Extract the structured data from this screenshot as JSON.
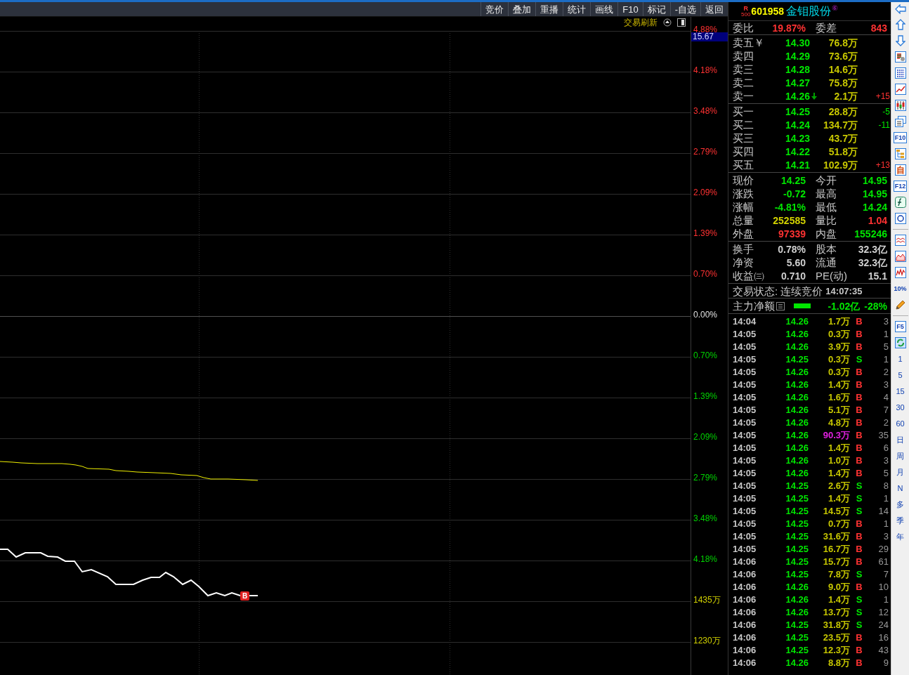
{
  "toolbar": [
    "竞价",
    "叠加",
    "重播",
    "统计",
    "画线",
    "F10",
    "标记",
    "-自选",
    "返回"
  ],
  "chart": {
    "refresh_label": "交易刷新",
    "price_tag": "15.67",
    "axis_labels": [
      {
        "text": "4.88%",
        "color": "#ff3232"
      },
      {
        "text": "4.18%",
        "color": "#ff3232"
      },
      {
        "text": "3.48%",
        "color": "#ff3232"
      },
      {
        "text": "2.79%",
        "color": "#ff3232"
      },
      {
        "text": "2.09%",
        "color": "#ff3232"
      },
      {
        "text": "1.39%",
        "color": "#ff3232"
      },
      {
        "text": "0.70%",
        "color": "#ff3232"
      },
      {
        "text": "0.00%",
        "color": "#e0e0e0"
      },
      {
        "text": "0.70%",
        "color": "#00d200"
      },
      {
        "text": "1.39%",
        "color": "#00d200"
      },
      {
        "text": "2.09%",
        "color": "#00d200"
      },
      {
        "text": "2.79%",
        "color": "#00d200"
      },
      {
        "text": "3.48%",
        "color": "#00d200"
      },
      {
        "text": "4.18%",
        "color": "#00d200"
      },
      {
        "text": "1435万",
        "color": "#d2d200"
      },
      {
        "text": "1230万",
        "color": "#d2d200"
      }
    ],
    "marker": "B"
  },
  "quote": {
    "market_tag": "R",
    "index_tag": "500",
    "code": "601958",
    "name": "金钼股份",
    "badge": "⑥",
    "ratio": {
      "label": "委比",
      "value": "19.87%",
      "diff_label": "委差",
      "diff": "843"
    },
    "asks": [
      {
        "label": "卖五￥",
        "price": "14.30",
        "volume": "76.8万",
        "tick_down": false
      },
      {
        "label": "卖四",
        "price": "14.29",
        "volume": "73.6万",
        "tick_down": false
      },
      {
        "label": "卖三",
        "price": "14.28",
        "volume": "14.6万",
        "tick_down": false
      },
      {
        "label": "卖二",
        "price": "14.27",
        "volume": "75.8万",
        "tick_down": false
      },
      {
        "label": "卖一",
        "price": "14.26",
        "volume": "2.1万",
        "change": "+15",
        "up": true,
        "tick_down": true
      }
    ],
    "bids": [
      {
        "label": "买一",
        "price": "14.25",
        "volume": "28.8万",
        "change": "-5",
        "up": false,
        "tick_down": false
      },
      {
        "label": "买二",
        "price": "14.24",
        "volume": "134.7万",
        "change": "-11",
        "up": false,
        "tick_down": false
      },
      {
        "label": "买三",
        "price": "14.23",
        "volume": "43.7万",
        "tick_down": false
      },
      {
        "label": "买四",
        "price": "14.22",
        "volume": "51.8万",
        "tick_down": false
      },
      {
        "label": "买五",
        "price": "14.21",
        "volume": "102.9万",
        "change": "+13",
        "up": true,
        "tick_down": false
      }
    ],
    "stats": [
      [
        {
          "label": "现价",
          "value": "14.25",
          "color": "#00e600"
        },
        {
          "label": "今开",
          "value": "14.95",
          "color": "#00e600"
        }
      ],
      [
        {
          "label": "涨跌",
          "value": "-0.72",
          "color": "#00e600"
        },
        {
          "label": "最高",
          "value": "14.95",
          "color": "#00e600"
        }
      ],
      [
        {
          "label": "涨幅",
          "value": "-4.81%",
          "color": "#00e600"
        },
        {
          "label": "最低",
          "value": "14.24",
          "color": "#00e600"
        }
      ],
      [
        {
          "label": "总量",
          "value": "252585",
          "color": "#d2d200"
        },
        {
          "label": "量比",
          "value": "1.04",
          "color": "#ff3232"
        }
      ],
      [
        {
          "label": "外盘",
          "value": "97339",
          "color": "#ff3232"
        },
        {
          "label": "内盘",
          "value": "155246",
          "color": "#00e600"
        }
      ]
    ],
    "fundamentals": [
      [
        {
          "label": "换手",
          "value": "0.78%",
          "color": "#d0d0d0"
        },
        {
          "label": "股本",
          "value": "32.3亿",
          "color": "#d0d0d0"
        }
      ],
      [
        {
          "label": "净资",
          "value": "5.60",
          "color": "#d0d0d0"
        },
        {
          "label": "流通",
          "value": "32.3亿",
          "color": "#d0d0d0"
        }
      ],
      [
        {
          "label": "收益㈢",
          "value": "0.710",
          "color": "#d0d0d0"
        },
        {
          "label": "PE(动)",
          "value": "15.1",
          "color": "#d0d0d0"
        }
      ]
    ],
    "status": {
      "text": "交易状态: 连续竞价",
      "time": "14:07:35"
    },
    "main_flow": {
      "label": "主力净额",
      "amount": "-1.02亿",
      "percent": "-28%",
      "level": 0.5
    }
  },
  "trades": [
    {
      "time": "14:04",
      "price": "14.26",
      "volume": "1.7万",
      "side": "B",
      "count": "3",
      "large": false
    },
    {
      "time": "14:05",
      "price": "14.26",
      "volume": "0.3万",
      "side": "B",
      "count": "1",
      "large": false
    },
    {
      "time": "14:05",
      "price": "14.26",
      "volume": "3.9万",
      "side": "B",
      "count": "5",
      "large": false
    },
    {
      "time": "14:05",
      "price": "14.25",
      "volume": "0.3万",
      "side": "S",
      "count": "1",
      "large": false
    },
    {
      "time": "14:05",
      "price": "14.26",
      "volume": "0.3万",
      "side": "B",
      "count": "2",
      "large": false
    },
    {
      "time": "14:05",
      "price": "14.26",
      "volume": "1.4万",
      "side": "B",
      "count": "3",
      "large": false
    },
    {
      "time": "14:05",
      "price": "14.26",
      "volume": "1.6万",
      "side": "B",
      "count": "4",
      "large": false
    },
    {
      "time": "14:05",
      "price": "14.26",
      "volume": "5.1万",
      "side": "B",
      "count": "7",
      "large": false
    },
    {
      "time": "14:05",
      "price": "14.26",
      "volume": "4.8万",
      "side": "B",
      "count": "2",
      "large": false
    },
    {
      "time": "14:05",
      "price": "14.26",
      "volume": "90.3万",
      "side": "B",
      "count": "35",
      "large": true
    },
    {
      "time": "14:05",
      "price": "14.26",
      "volume": "1.4万",
      "side": "B",
      "count": "6",
      "large": false
    },
    {
      "time": "14:05",
      "price": "14.26",
      "volume": "1.0万",
      "side": "B",
      "count": "3",
      "large": false
    },
    {
      "time": "14:05",
      "price": "14.26",
      "volume": "1.4万",
      "side": "B",
      "count": "5",
      "large": false
    },
    {
      "time": "14:05",
      "price": "14.25",
      "volume": "2.6万",
      "side": "S",
      "count": "8",
      "large": false
    },
    {
      "time": "14:05",
      "price": "14.25",
      "volume": "1.4万",
      "side": "S",
      "count": "1",
      "large": false
    },
    {
      "time": "14:05",
      "price": "14.25",
      "volume": "14.5万",
      "side": "S",
      "count": "14",
      "large": false
    },
    {
      "time": "14:05",
      "price": "14.25",
      "volume": "0.7万",
      "side": "B",
      "count": "1",
      "large": false
    },
    {
      "time": "14:05",
      "price": "14.25",
      "volume": "31.6万",
      "side": "B",
      "count": "3",
      "large": false
    },
    {
      "time": "14:05",
      "price": "14.25",
      "volume": "16.7万",
      "side": "B",
      "count": "29",
      "large": false
    },
    {
      "time": "14:06",
      "price": "14.25",
      "volume": "15.7万",
      "side": "B",
      "count": "61",
      "large": false
    },
    {
      "time": "14:06",
      "price": "14.25",
      "volume": "7.8万",
      "side": "S",
      "count": "7",
      "large": false
    },
    {
      "time": "14:06",
      "price": "14.26",
      "volume": "9.0万",
      "side": "B",
      "count": "10",
      "large": false
    },
    {
      "time": "14:06",
      "price": "14.26",
      "volume": "1.4万",
      "side": "S",
      "count": "1",
      "large": false
    },
    {
      "time": "14:06",
      "price": "14.26",
      "volume": "13.7万",
      "side": "S",
      "count": "12",
      "large": false
    },
    {
      "time": "14:06",
      "price": "14.25",
      "volume": "31.8万",
      "side": "S",
      "count": "24",
      "large": false
    },
    {
      "time": "14:06",
      "price": "14.25",
      "volume": "23.5万",
      "side": "B",
      "count": "16",
      "large": false
    },
    {
      "time": "14:06",
      "price": "14.25",
      "volume": "12.3万",
      "side": "B",
      "count": "43",
      "large": false
    },
    {
      "time": "14:06",
      "price": "14.26",
      "volume": "8.8万",
      "side": "B",
      "count": "9",
      "large": false
    }
  ],
  "side_toolbar": {
    "text_icons": [
      "F10",
      "自",
      "F12",
      "10%",
      "F5"
    ],
    "periods": [
      "1",
      "5",
      "15",
      "30",
      "60",
      "日",
      "周",
      "月",
      "N",
      "多",
      "季",
      "年"
    ]
  }
}
